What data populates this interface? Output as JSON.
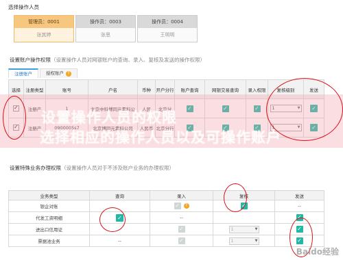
{
  "select_operator": {
    "title": "选择操作人员",
    "operators": [
      {
        "role": "管理员：0001",
        "name": "张其婷",
        "active": true
      },
      {
        "role": "操作员：0003",
        "name": "张思",
        "active": false
      },
      {
        "role": "操作员：0004",
        "name": "王明明",
        "active": false
      }
    ]
  },
  "account_perm": {
    "title": "设置账户操作权限",
    "hint": "（设置操作人员对网银账户的查询、录入、复核及发送的操作权限）",
    "tabs": [
      {
        "label": "注册账户",
        "active": true
      },
      {
        "label": "授权账户",
        "active": false,
        "badge": "?"
      }
    ],
    "columns": [
      "选择",
      "注册类型",
      "账号",
      "户名",
      "币种",
      "开户分行",
      "账户查询",
      "网银交易查询",
      "录入权限",
      "复核级别",
      "发送"
    ],
    "rows": [
      {
        "checked": true,
        "type": "注册产",
        "account": "1",
        "name": "北京中科博同元素科公",
        "currency": "人民",
        "branch": "北京分",
        "review_level": "1",
        "send": true
      },
      {
        "checked": true,
        "type": "注册产",
        "account": "0900005s7",
        "name": "北京博同元素科公司",
        "currency": "人民币",
        "branch": "北京分行",
        "review_level": "1",
        "send": true
      }
    ]
  },
  "band": {
    "line1": "设置操作人员的权限",
    "line2": "选择相应的操作人员以及可操作账户"
  },
  "special_perm": {
    "title": "设置特殊业务办理权限",
    "hint": "（设置操作人员对于不涉及账户业务的办理权限）",
    "columns": [
      "业务类型",
      "查询",
      "录入",
      "复核",
      "发送"
    ],
    "rows": [
      {
        "type": "银企对账",
        "query": "",
        "entry": "ghost",
        "review": "1",
        "send": "--"
      },
      {
        "type": "代发工资明细",
        "query": "check",
        "entry": "--",
        "review": "",
        "send": "check"
      },
      {
        "type": "进出口信用证",
        "query": "",
        "entry": "ghost",
        "review": "1",
        "send": "check"
      },
      {
        "type": "票据池业务",
        "query": "--",
        "entry": "ghost",
        "review": "1",
        "send": "check"
      }
    ]
  },
  "watermark": "Baido经验"
}
